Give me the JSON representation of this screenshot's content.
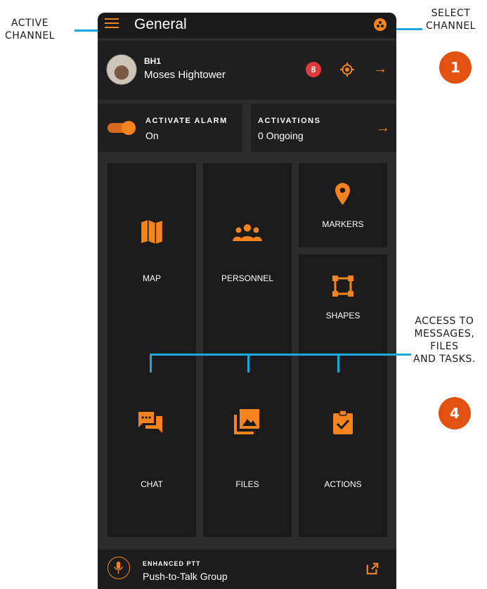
{
  "annotations": {
    "active_channel": "ACTIVE\nCHANNEL",
    "select_channel": "SELECT\nCHANNEL",
    "access": "ACCESS TO\nMESSAGES,\nFILES\nAND TASKS.",
    "badge_1": "1",
    "badge_4": "4"
  },
  "header": {
    "title": "General",
    "menu_icon": "menu-icon",
    "channel_icon": "channel-select-icon"
  },
  "user": {
    "callsign": "BH1",
    "name": "Moses Hightower",
    "medal_label": "8"
  },
  "alarm": {
    "label": "ACTIVATE ALARM",
    "value": "On"
  },
  "activations": {
    "label": "ACTIVATIONS",
    "value": "0 Ongoing"
  },
  "tiles": {
    "map": "MAP",
    "personnel": "PERSONNEL",
    "markers": "MARKERS",
    "shapes": "SHAPES",
    "chat": "CHAT",
    "files": "FILES",
    "actions": "ACTIONS"
  },
  "ptt": {
    "label": "ENHANCED PTT",
    "value": "Push-to-Talk Group"
  },
  "colors": {
    "accent": "#f5841f",
    "annotation_line": "#1ea8e0",
    "badge": "#e2510f",
    "tile": "#1b1b1b"
  }
}
